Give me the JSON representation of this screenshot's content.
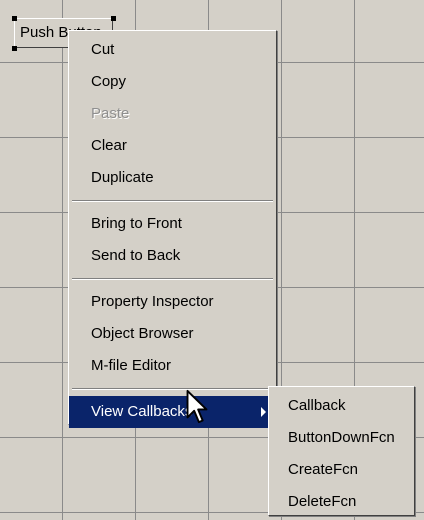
{
  "canvas": {
    "button_label": "Push Button"
  },
  "context_menu": {
    "items": [
      {
        "label": "Cut",
        "enabled": true
      },
      {
        "label": "Copy",
        "enabled": true
      },
      {
        "label": "Paste",
        "enabled": false
      },
      {
        "label": "Clear",
        "enabled": true
      },
      {
        "label": "Duplicate",
        "enabled": true
      },
      {
        "label": "Bring to Front",
        "enabled": true
      },
      {
        "label": "Send to Back",
        "enabled": true
      },
      {
        "label": "Property Inspector",
        "enabled": true
      },
      {
        "label": "Object Browser",
        "enabled": true
      },
      {
        "label": "M-file Editor",
        "enabled": true
      },
      {
        "label": "View Callbacks",
        "enabled": true,
        "highlighted": true,
        "has_submenu": true
      }
    ]
  },
  "submenu": {
    "items": [
      {
        "label": "Callback"
      },
      {
        "label": "ButtonDownFcn"
      },
      {
        "label": "CreateFcn"
      },
      {
        "label": "DeleteFcn"
      }
    ]
  },
  "colors": {
    "menu_background": "#d4d0c8",
    "highlight": "#0a246a",
    "highlight_text": "#ffffff",
    "disabled_text": "#8f8f8f",
    "grid_line": "#8a8a8a"
  },
  "icons": {
    "cursor": "arrow-pointer-icon",
    "submenu_arrow": "triangle-right-icon"
  }
}
